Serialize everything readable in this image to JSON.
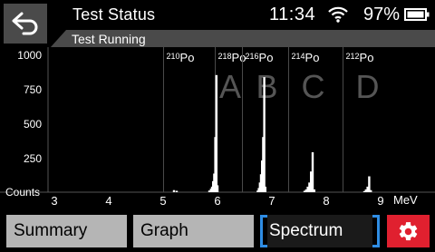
{
  "header": {
    "title": "Test Status",
    "time": "11:34",
    "battery_percent": "97%"
  },
  "subheader": {
    "status": "Test Running"
  },
  "chart_data": {
    "type": "bar",
    "ylabel": "Counts",
    "xlabel": "MeV",
    "xlim": [
      3,
      9.7
    ],
    "ylim": [
      0,
      1050
    ],
    "y_ticks": [
      "1000",
      "750",
      "500",
      "250"
    ],
    "x_ticks": [
      "3",
      "4",
      "5",
      "6",
      "7",
      "8",
      "9"
    ],
    "regions": [
      {
        "iso_mass": "210",
        "iso_sym": "Po",
        "letter": "",
        "start": 5.0,
        "end": 5.95
      },
      {
        "iso_mass": "218",
        "iso_sym": "Po",
        "letter": "A",
        "start": 5.95,
        "end": 6.45
      },
      {
        "iso_mass": "216",
        "iso_sym": "Po",
        "letter": "B",
        "start": 6.45,
        "end": 7.3
      },
      {
        "iso_mass": "214",
        "iso_sym": "Po",
        "letter": "C",
        "start": 7.3,
        "end": 8.3
      },
      {
        "iso_mass": "212",
        "iso_sym": "Po",
        "letter": "D",
        "start": 8.3,
        "end": 9.7
      }
    ],
    "bars": [
      {
        "x": 5.2,
        "y": 15
      },
      {
        "x": 5.25,
        "y": 10
      },
      {
        "x": 5.85,
        "y": 12
      },
      {
        "x": 5.88,
        "y": 25
      },
      {
        "x": 5.9,
        "y": 40
      },
      {
        "x": 5.92,
        "y": 80
      },
      {
        "x": 5.94,
        "y": 135
      },
      {
        "x": 5.96,
        "y": 400
      },
      {
        "x": 5.98,
        "y": 850
      },
      {
        "x": 6.0,
        "y": 50
      },
      {
        "x": 6.74,
        "y": 12
      },
      {
        "x": 6.76,
        "y": 30
      },
      {
        "x": 6.78,
        "y": 70
      },
      {
        "x": 6.8,
        "y": 130
      },
      {
        "x": 6.82,
        "y": 230
      },
      {
        "x": 6.84,
        "y": 400
      },
      {
        "x": 6.86,
        "y": 835
      },
      {
        "x": 6.88,
        "y": 40
      },
      {
        "x": 7.6,
        "y": 10
      },
      {
        "x": 7.63,
        "y": 20
      },
      {
        "x": 7.66,
        "y": 40
      },
      {
        "x": 7.69,
        "y": 70
      },
      {
        "x": 7.72,
        "y": 150
      },
      {
        "x": 7.75,
        "y": 290
      },
      {
        "x": 7.78,
        "y": 20
      },
      {
        "x": 8.7,
        "y": 8
      },
      {
        "x": 8.73,
        "y": 20
      },
      {
        "x": 8.76,
        "y": 40
      },
      {
        "x": 8.79,
        "y": 115
      },
      {
        "x": 8.82,
        "y": 15
      }
    ]
  },
  "tabs": [
    {
      "label": "Summary"
    },
    {
      "label": "Graph"
    },
    {
      "label": "Spectrum"
    }
  ],
  "colors": {
    "accent": "#2f8de4",
    "settings": "#e0202f",
    "tab": "#b5b5b5",
    "bar": "#ffffff"
  },
  "icons": {
    "back": "back-arrow-icon",
    "wifi": "wifi-icon",
    "battery": "battery-icon",
    "settings": "gear-icon"
  }
}
